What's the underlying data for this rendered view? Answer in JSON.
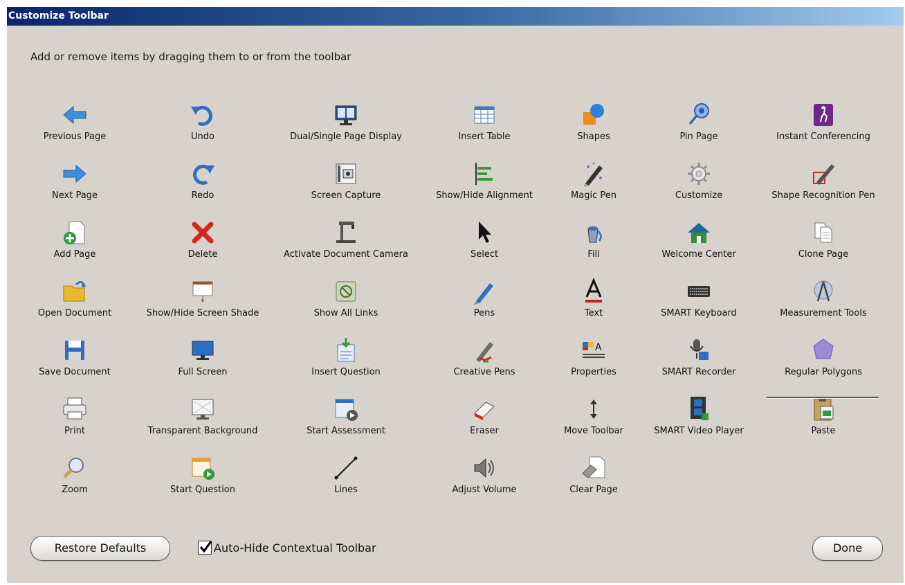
{
  "window": {
    "title": "Customize Toolbar"
  },
  "instruction": "Add or remove items by dragging them to or from the toolbar",
  "items": [
    {
      "label": "Previous Page",
      "icon": "previous-page-icon"
    },
    {
      "label": "Undo",
      "icon": "undo-icon"
    },
    {
      "label": "Dual/Single Page Display",
      "icon": "dual-page-display-icon"
    },
    {
      "label": "Insert Table",
      "icon": "table-icon"
    },
    {
      "label": "Shapes",
      "icon": "shapes-icon"
    },
    {
      "label": "Pin Page",
      "icon": "pin-icon"
    },
    {
      "label": "Instant Conferencing",
      "icon": "conferencing-icon"
    },
    {
      "label": "Next Page",
      "icon": "next-page-icon"
    },
    {
      "label": "Redo",
      "icon": "redo-icon"
    },
    {
      "label": "Screen Capture",
      "icon": "screen-capture-icon"
    },
    {
      "label": "Show/Hide Alignment",
      "icon": "alignment-icon"
    },
    {
      "label": "Magic Pen",
      "icon": "magic-pen-icon"
    },
    {
      "label": "Customize",
      "icon": "gear-icon"
    },
    {
      "label": "Shape Recognition Pen",
      "icon": "shape-recognition-pen-icon"
    },
    {
      "label": "Add Page",
      "icon": "add-page-icon"
    },
    {
      "label": "Delete",
      "icon": "delete-icon"
    },
    {
      "label": "Activate Document Camera",
      "icon": "document-camera-icon"
    },
    {
      "label": "Select",
      "icon": "cursor-arrow-icon"
    },
    {
      "label": "Fill",
      "icon": "paint-bucket-icon"
    },
    {
      "label": "Welcome Center",
      "icon": "home-icon"
    },
    {
      "label": "Clone Page",
      "icon": "clone-page-icon"
    },
    {
      "label": "Open Document",
      "icon": "folder-icon"
    },
    {
      "label": "Show/Hide Screen Shade",
      "icon": "screen-shade-icon"
    },
    {
      "label": "Show All Links",
      "icon": "links-icon"
    },
    {
      "label": "Pens",
      "icon": "pen-icon"
    },
    {
      "label": "Text",
      "icon": "text-icon"
    },
    {
      "label": "SMART Keyboard",
      "icon": "keyboard-icon"
    },
    {
      "label": "Measurement Tools",
      "icon": "compass-icon"
    },
    {
      "label": "Save Document",
      "icon": "floppy-disk-icon"
    },
    {
      "label": "Full Screen",
      "icon": "monitor-icon"
    },
    {
      "label": "Insert Question",
      "icon": "insert-question-icon"
    },
    {
      "label": "Creative Pens",
      "icon": "creative-pen-icon"
    },
    {
      "label": "Properties",
      "icon": "properties-icon"
    },
    {
      "label": "SMART Recorder",
      "icon": "recorder-icon"
    },
    {
      "label": "Regular Polygons",
      "icon": "polygon-icon"
    },
    {
      "label": "Print",
      "icon": "printer-icon"
    },
    {
      "label": "Transparent Background",
      "icon": "transparent-background-icon"
    },
    {
      "label": "Start Assessment",
      "icon": "assessment-icon"
    },
    {
      "label": "Eraser",
      "icon": "eraser-icon"
    },
    {
      "label": "Move Toolbar",
      "icon": "move-arrows-icon"
    },
    {
      "label": "SMART Video Player",
      "icon": "film-icon"
    },
    {
      "label": "Paste",
      "icon": "clipboard-icon"
    },
    {
      "label": "Zoom",
      "icon": "magnifier-icon"
    },
    {
      "label": "Start Question",
      "icon": "start-question-icon"
    },
    {
      "label": "Lines",
      "icon": "line-icon"
    },
    {
      "label": "Adjust Volume",
      "icon": "speaker-icon"
    },
    {
      "label": "Clear Page",
      "icon": "clear-page-icon"
    }
  ],
  "footer": {
    "restore_label": "Restore Defaults",
    "checkbox_label": "Auto-Hide Contextual Toolbar",
    "checkbox_checked": true,
    "done_label": "Done"
  },
  "colors": {
    "titlebar_start": "#0a246a",
    "titlebar_end": "#a6caf0",
    "dialog_background": "#d7d3cc"
  }
}
